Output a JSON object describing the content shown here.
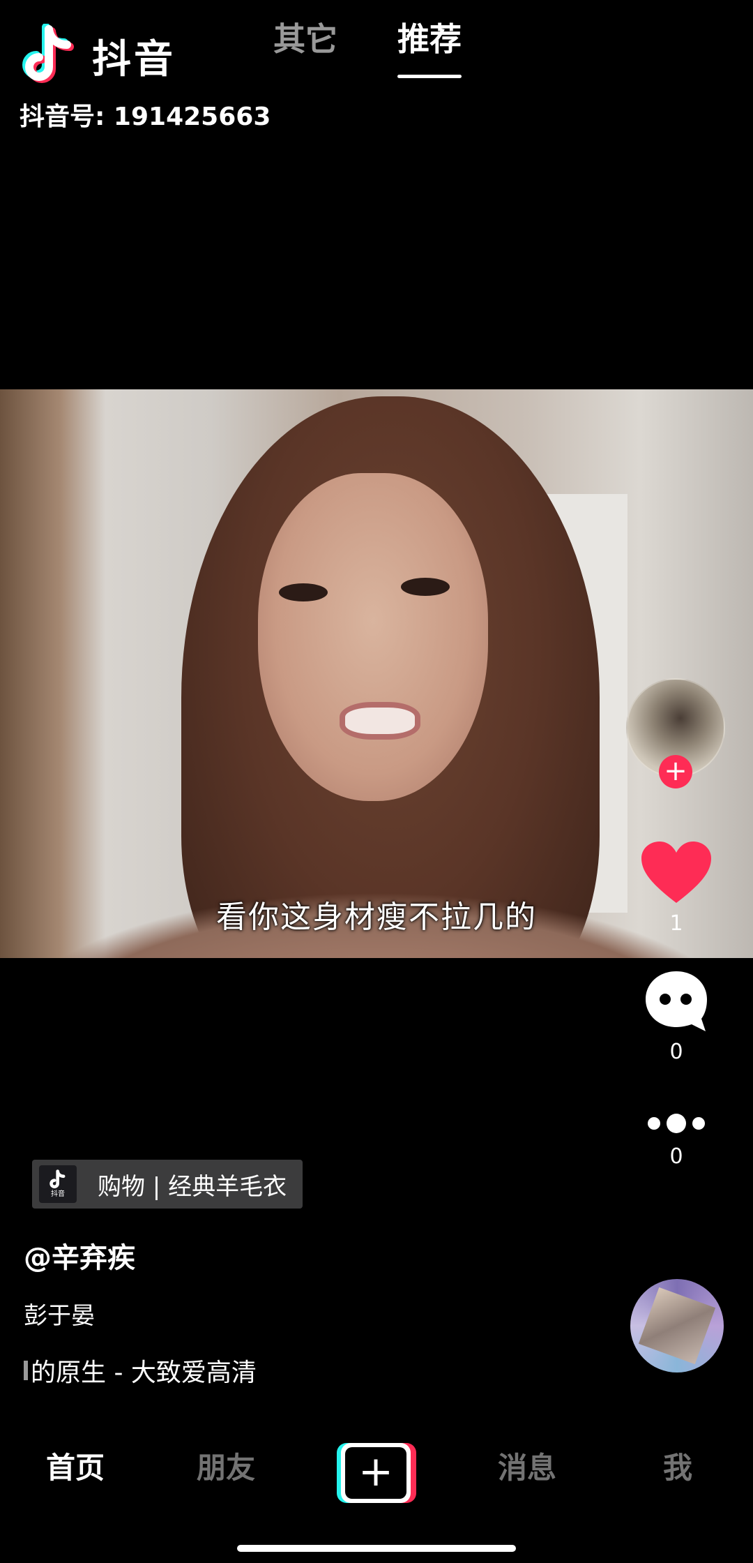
{
  "header": {
    "app_name": "抖音",
    "account_label": "抖音号: 191425663",
    "tabs": [
      {
        "label": "其它",
        "active": false
      },
      {
        "label": "推荐",
        "active": true
      }
    ]
  },
  "video": {
    "subtitle": "看你这身材瘦不拉几的"
  },
  "rail": {
    "like_count": "1",
    "comment_count": "0",
    "share_count": "0",
    "follow_symbol": "+"
  },
  "info": {
    "shop_label": "购物 | 经典羊毛衣",
    "shop_icon_text": "抖音",
    "username": "@辛弃疾",
    "description": "彭于晏",
    "music": "的原生 - 大致爱高清"
  },
  "nav": {
    "items": [
      "首页",
      "朋友",
      "消息",
      "我"
    ],
    "active": "首页",
    "create_symbol": "+"
  },
  "colors": {
    "accent_red": "#fe2c55",
    "accent_cyan": "#25f4ee",
    "background": "#000000"
  }
}
